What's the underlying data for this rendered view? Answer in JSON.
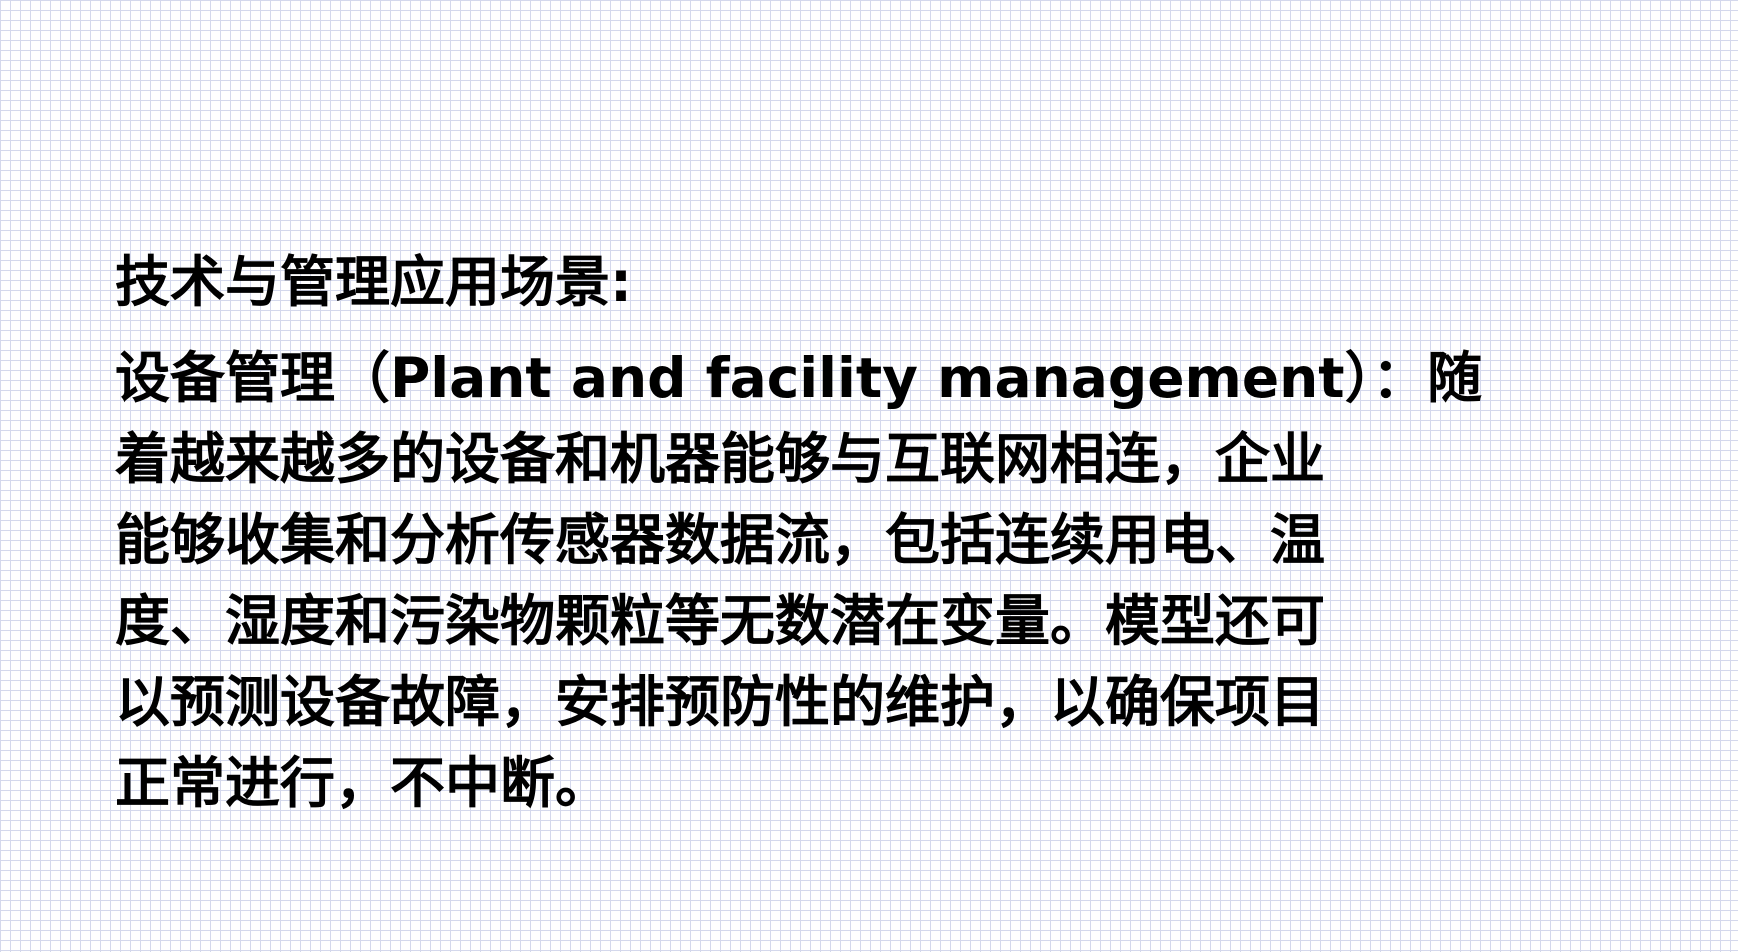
{
  "slide": {
    "heading": "技术与管理应用场景:",
    "paragraph_lines": [
      "设备管理（Plant and facility management）：随",
      "着越来越多的设备和机器能够与互联网相连，企业",
      "能够收集和分析传感器数据流，包括连续用电、温",
      "度、湿度和污染物颗粒等无数潜在变量。模型还可",
      "以预测设备故障，安排预防性的维护，以确保项目",
      "正常进行，不中断。"
    ]
  },
  "colors": {
    "background": "#ffffff",
    "grid": "#d4d8ec",
    "text": "#000000"
  }
}
